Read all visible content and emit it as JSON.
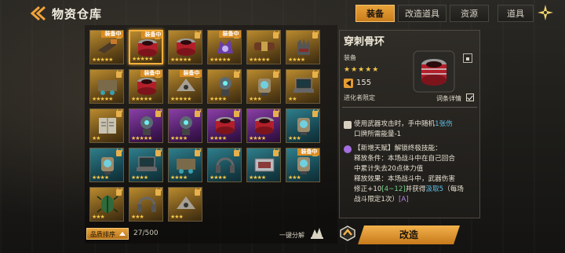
{
  "header": {
    "title": "物资仓库",
    "tabs": [
      {
        "label": "装备",
        "active": true
      },
      {
        "label": "改造道具",
        "active": false
      },
      {
        "label": "资源",
        "active": false
      },
      {
        "label": "道具",
        "active": false
      }
    ]
  },
  "grid": {
    "rows": [
      [
        {
          "rarity": "gold",
          "icon": "gun-icon",
          "stars": "★★★★★",
          "equipped": "装备中",
          "locked": true
        },
        {
          "rarity": "gold",
          "icon": "bracelet-icon",
          "stars": "★★★★★",
          "equipped": "装备中",
          "locked": true,
          "selected": true
        },
        {
          "rarity": "gold",
          "icon": "bracelet-icon",
          "stars": "★★★★★",
          "equipped": "",
          "locked": true
        },
        {
          "rarity": "gold",
          "icon": "purple-beast-icon",
          "stars": "★★★★★",
          "equipped": "装备中",
          "locked": true
        },
        {
          "rarity": "gold",
          "icon": "belt-icon",
          "stars": "★★★★★",
          "equipped": "",
          "locked": true
        },
        {
          "rarity": "gold",
          "icon": "glove-icon",
          "stars": "★★★★",
          "equipped": "",
          "locked": true
        }
      ],
      [
        {
          "rarity": "gold",
          "icon": "cannon-icon",
          "stars": "★★★★★",
          "equipped": "",
          "locked": true
        },
        {
          "rarity": "gold",
          "icon": "bracelet-icon",
          "stars": "★★★★★",
          "equipped": "装备中",
          "locked": true
        },
        {
          "rarity": "gold",
          "icon": "drone-icon",
          "stars": "★★★★★",
          "equipped": "装备中",
          "locked": true
        },
        {
          "rarity": "gold",
          "icon": "robot-icon",
          "stars": "★★★★",
          "equipped": "",
          "locked": true
        },
        {
          "rarity": "gold",
          "icon": "sensor-icon",
          "stars": "★★★",
          "equipped": "",
          "locked": true
        },
        {
          "rarity": "gold",
          "icon": "laptop-icon",
          "stars": "★★",
          "equipped": "",
          "locked": true
        }
      ],
      [
        {
          "rarity": "gold",
          "icon": "book-icon",
          "stars": "★★",
          "equipped": "",
          "locked": true
        },
        {
          "rarity": "purple",
          "icon": "robot-icon",
          "stars": "★★★★★",
          "equipped": "",
          "locked": true
        },
        {
          "rarity": "purple",
          "icon": "robot-icon",
          "stars": "★★★★",
          "equipped": "",
          "locked": true
        },
        {
          "rarity": "purple",
          "icon": "bracelet-icon",
          "stars": "★★★★",
          "equipped": "",
          "locked": true
        },
        {
          "rarity": "purple",
          "icon": "bracelet-icon",
          "stars": "★★★★",
          "equipped": "",
          "locked": true
        },
        {
          "rarity": "blue",
          "icon": "sensor-icon",
          "stars": "★★★",
          "equipped": "",
          "locked": true
        }
      ],
      [
        {
          "rarity": "blue",
          "icon": "sensor-icon",
          "stars": "★★★★",
          "equipped": "",
          "locked": true
        },
        {
          "rarity": "blue",
          "icon": "laptop-icon",
          "stars": "★★★★",
          "equipped": "",
          "locked": true
        },
        {
          "rarity": "blue",
          "icon": "cannon-icon",
          "stars": "★★★★",
          "equipped": "",
          "locked": true
        },
        {
          "rarity": "blue",
          "icon": "headphone-icon",
          "stars": "★★★★",
          "equipped": "",
          "locked": true
        },
        {
          "rarity": "blue",
          "icon": "case-icon",
          "stars": "★★★★",
          "equipped": "",
          "locked": true
        },
        {
          "rarity": "blue",
          "icon": "sensor-icon",
          "stars": "★★★",
          "equipped": "装备中",
          "locked": true
        }
      ],
      [
        {
          "rarity": "gold",
          "icon": "beetle-icon",
          "stars": "★★★",
          "equipped": "",
          "locked": true
        },
        {
          "rarity": "gold",
          "icon": "headphone-icon",
          "stars": "★★★",
          "equipped": "",
          "locked": true
        },
        {
          "rarity": "gold",
          "icon": "drone-icon",
          "stars": "★★★",
          "equipped": "",
          "locked": true
        }
      ]
    ]
  },
  "bottom": {
    "sort_label": "品质排序",
    "count": "27/500",
    "decompose_label": "一键分解"
  },
  "detail": {
    "name": "穿刺骨环",
    "type": "装备",
    "stars": "★★★★★",
    "power": "155",
    "restrict": "进化者限定",
    "entry_detail": "词条详情",
    "effect1": {
      "l1a": "使用武器攻击时，手中随机",
      "l1b": "1张",
      "l1c": "伤",
      "l2": "口牌所需能量-1"
    },
    "effect2": {
      "l1": "【新增天赋】解锁终极技能：",
      "l2": "释放条件：本场战斗中在自己回合",
      "l3": "中累计失去20点体力值",
      "l4": "释放效果：本场战斗中，武器伤害",
      "l5a": "修正+10",
      "l5b": "[4~12]",
      "l5c": "并获得",
      "l5d": "汲取5",
      "l5e": "（每场",
      "l6a": "战斗限定1次）",
      "l6b": "[A]"
    },
    "upgrade_label": "改造"
  },
  "colors": {
    "accent": "#e9a33a",
    "gold_rarity": "#b98a2e",
    "purple_rarity": "#8a3fa6",
    "blue_rarity": "#2f7e8c",
    "highlight": "#5ec2e9"
  }
}
